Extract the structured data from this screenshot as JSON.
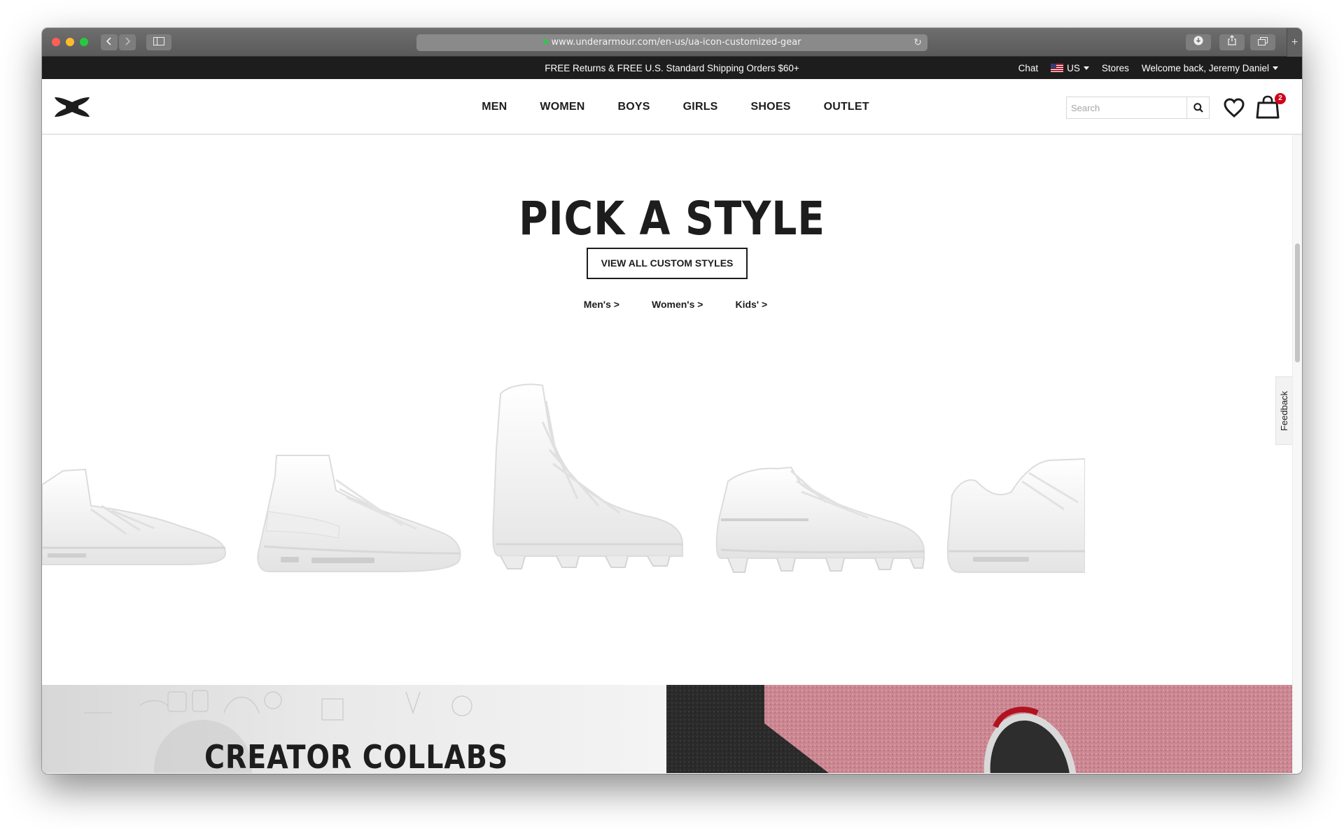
{
  "browser": {
    "url": "www.underarmour.com/en-us/ua-icon-customized-gear",
    "back_icon": "chevron-left-icon",
    "forward_icon": "chevron-right-icon",
    "sidebar_icon": "sidebar-icon",
    "download_icon": "download-icon",
    "share_icon": "share-icon",
    "tabs_icon": "tabs-icon",
    "new_tab_label": "+"
  },
  "promo": {
    "message": "FREE Returns & FREE U.S. Standard Shipping Orders $60+",
    "chat": "Chat",
    "country": "US",
    "stores": "Stores",
    "welcome": "Welcome back, Jeremy Daniel"
  },
  "header": {
    "nav": [
      "MEN",
      "WOMEN",
      "BOYS",
      "GIRLS",
      "SHOES",
      "OUTLET"
    ],
    "search_placeholder": "Search",
    "cart_count": "2"
  },
  "main": {
    "title": "PICK A STYLE",
    "view_all": "VIEW ALL CUSTOM STYLES",
    "sublinks": [
      "Men's  >",
      "Women's  >",
      "Kids'  >"
    ],
    "feedback": "Feedback",
    "collab_title": "CREATOR COLLABS"
  },
  "colors": {
    "promo_bg": "#1d1d1d",
    "badge": "#d0021b",
    "accent_pink": "#d58d96"
  }
}
